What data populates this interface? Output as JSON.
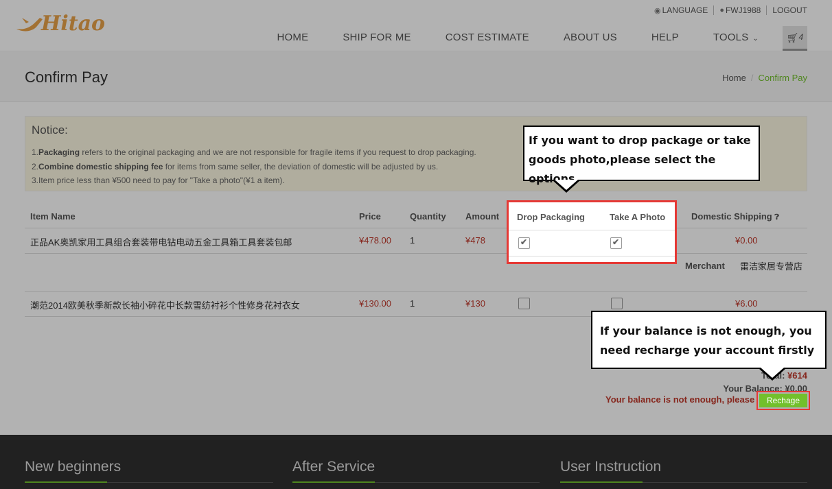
{
  "logo": {
    "text": "Hitao"
  },
  "toplinks": {
    "language": "LANGUAGE",
    "user": "FWJ1988",
    "logout": "LOGOUT"
  },
  "nav": {
    "home": "HOME",
    "ship": "SHIP FOR ME",
    "cost": "COST ESTIMATE",
    "about": "ABOUT US",
    "help": "HELP",
    "tools": "TOOLS",
    "cart_count": "4"
  },
  "page": {
    "title": "Confirm Pay",
    "breadcrumb_home": "Home",
    "breadcrumb_current": "Confirm Pay"
  },
  "notice": {
    "title": "Notice:",
    "l1_prefix": "1.",
    "l1_bold": "Packaging",
    "l1_rest": " refers to the original packaging and we are not responsible for fragile items if you request to drop packaging.",
    "l2_prefix": "2.",
    "l2_bold": "Combine domestic shipping fee",
    "l2_rest": " for items from same seller, the deviation of domestic will be adjusted by us.",
    "l3": "3.Item price less than ¥500 need to pay for \"Take a photo\"(¥1 a item)."
  },
  "table": {
    "headers": {
      "name": "Item Name",
      "price": "Price",
      "quantity": "Quantity",
      "amount": "Amount",
      "drop": "Drop Packaging",
      "photo": "Take A Photo",
      "shipping": "Domestic Shipping"
    },
    "rows": [
      {
        "name": "正品AK奥凯家用工具组合套装带电钻电动五金工具箱工具套装包邮",
        "price": "¥478.00",
        "quantity": "1",
        "amount": "¥478",
        "shipping": "¥0.00",
        "drop": true,
        "photo": true
      },
      {
        "name": "潮范2014欧美秋季新款长袖小碎花中长款雪纺衬衫个性修身花衬衣女",
        "price": "¥130.00",
        "quantity": "1",
        "amount": "¥130",
        "shipping": "¥6.00",
        "drop": false,
        "photo": false
      }
    ],
    "merchant_label": "Merchant",
    "merchant_name": "雷洁家居专营店"
  },
  "totals": {
    "total_label": "Total: ",
    "total": "¥614",
    "balance_label": "Your Balance: ",
    "balance": "¥0.00",
    "warning": "Your balance is not enough, please",
    "recharge": "Rechage"
  },
  "footer": {
    "col1": "New beginners",
    "col2": "After Service",
    "col3": "User Instruction"
  },
  "callouts": {
    "options": "If you want to drop package or take goods photo,please select the options",
    "balance": "If your balance is not enough, you need recharge your account firstly"
  },
  "colors": {
    "accent": "#72c02c",
    "price": "#c0392b",
    "highlight": "#e53935"
  }
}
